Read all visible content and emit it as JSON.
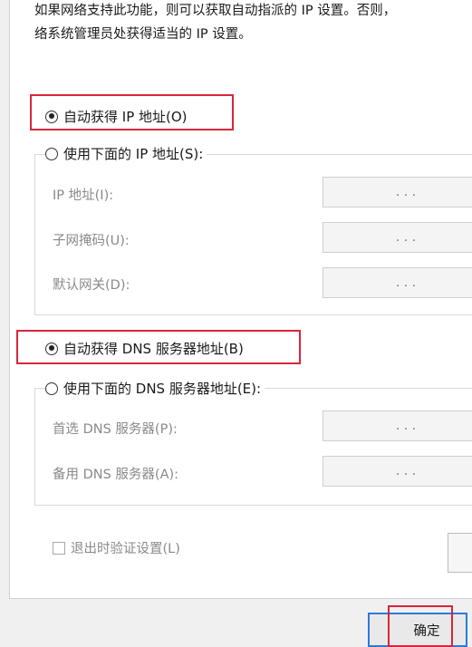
{
  "description": {
    "line1": "如果网络支持此功能，则可以获取自动指派的 IP 设置。否则，",
    "line2": "络系统管理员处获得适当的 IP 设置。"
  },
  "ip_section": {
    "auto_label": "自动获得 IP 地址(O)",
    "manual_label": "使用下面的 IP 地址(S):",
    "selected": "auto",
    "fields": [
      {
        "label": "IP 地址(I):",
        "value": ".   .   ."
      },
      {
        "label": "子网掩码(U):",
        "value": ".   .   ."
      },
      {
        "label": "默认网关(D):",
        "value": ".   .   ."
      }
    ]
  },
  "dns_section": {
    "auto_label": "自动获得 DNS 服务器地址(B)",
    "manual_label": "使用下面的 DNS 服务器地址(E):",
    "selected": "auto",
    "fields": [
      {
        "label": "首选 DNS 服务器(P):",
        "value": ".   .   ."
      },
      {
        "label": "备用 DNS 服务器(A):",
        "value": ".   .   ."
      }
    ]
  },
  "validate_checkbox": {
    "label": "退出时验证设置(L)",
    "checked": false
  },
  "buttons": {
    "ok_label": "确定"
  },
  "colors": {
    "highlight_box": "#d7263d",
    "focus_border": "#2f79d6"
  }
}
